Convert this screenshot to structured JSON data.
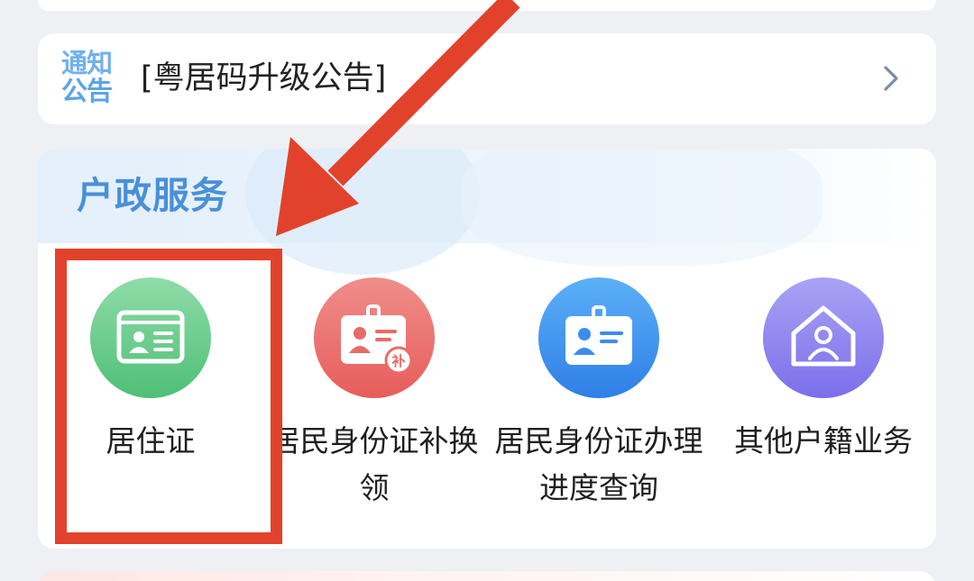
{
  "notice": {
    "badge_line1": "通知",
    "badge_line2": "公告",
    "text": "[粤居码升级公告]",
    "chevron_icon": "chevron-right-icon"
  },
  "service": {
    "title": "户政服务",
    "items": [
      {
        "label": "居住证",
        "icon": "id-card-icon",
        "color": "#5bc47f"
      },
      {
        "label": "居民身份证补换领",
        "icon": "badge-reissue-icon",
        "color": "#e96b68"
      },
      {
        "label": "居民身份证办理进度查询",
        "icon": "badge-progress-icon",
        "color": "#3c8ced"
      },
      {
        "label": "其他户籍业务",
        "icon": "house-person-icon",
        "color": "#8a80ee"
      }
    ]
  },
  "annotation": {
    "arrow_color": "#e2422b",
    "highlight_color": "#e2422b"
  }
}
